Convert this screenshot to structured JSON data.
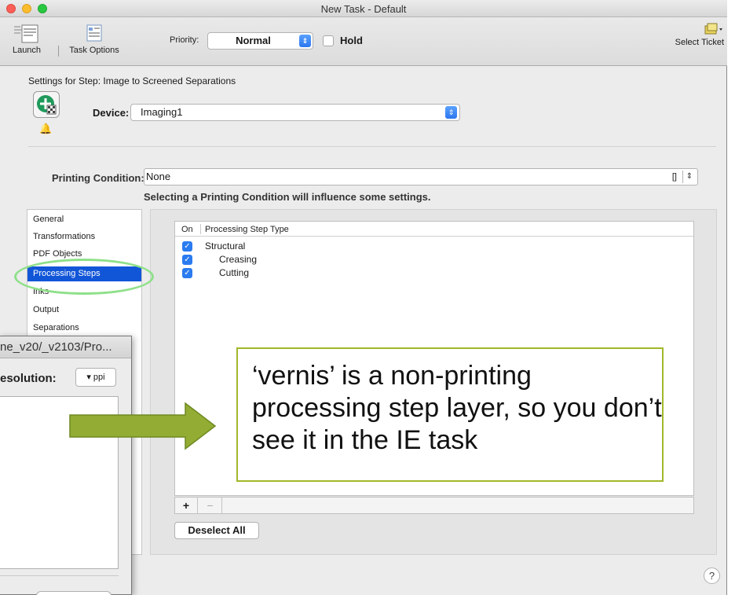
{
  "window": {
    "title": "New Task - Default"
  },
  "toolbar": {
    "launch_label": "Launch",
    "task_options_label": "Task Options",
    "priority_label": "Priority:",
    "priority_value": "Normal",
    "hold_label": "Hold",
    "select_ticket_label": "Select Ticket"
  },
  "settings": {
    "title": "Settings for Step: Image to Screened Separations",
    "device_label": "Device:",
    "device_value": "Imaging1",
    "printing_condition_label": "Printing Condition:",
    "printing_condition_value": "None",
    "printing_condition_brackets": "[]",
    "printing_condition_hint": "Selecting a Printing Condition will influence some settings."
  },
  "categories": [
    {
      "label": "General"
    },
    {
      "label": "Transformations"
    },
    {
      "label": "PDF Objects"
    },
    {
      "label": "Processing Steps",
      "selected": true
    },
    {
      "label": "Inks"
    },
    {
      "label": "Output"
    },
    {
      "label": "Separations"
    }
  ],
  "processing_steps": {
    "col_on": "On",
    "col_type": "Processing Step Type",
    "rows": [
      {
        "label": "Structural",
        "checked": true,
        "indent": 0
      },
      {
        "label": "Creasing",
        "checked": true,
        "indent": 1
      },
      {
        "label": "Cutting",
        "checked": true,
        "indent": 1
      }
    ],
    "add_label": "+",
    "remove_label": "−",
    "deselect_all_label": "Deselect All"
  },
  "help_label": "?",
  "overlay_window": {
    "title": "ne_v20/_v2103/Pro...",
    "resolution_label": "esolution:",
    "ppi_label": "▾ ppi"
  },
  "callout": {
    "text": "‘vernis’ is a non-printing processing step layer, so you don’t see it in the IE task",
    "border_color": "#a2b72a",
    "arrow_color": "#93ad34"
  }
}
